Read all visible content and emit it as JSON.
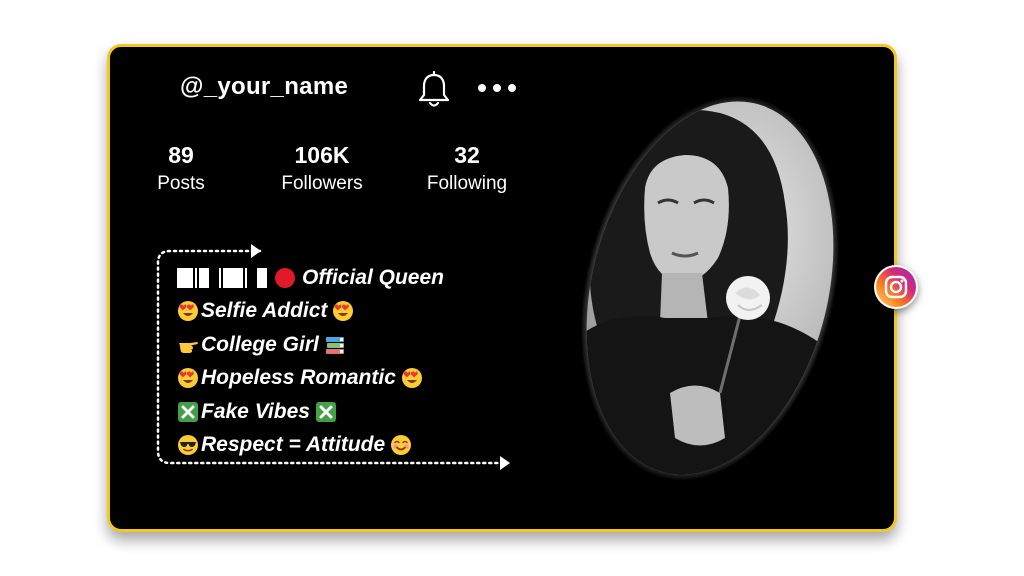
{
  "profile": {
    "username": "@_your_name",
    "stats": [
      {
        "value": "89",
        "label": "Posts"
      },
      {
        "value": "106K",
        "label": "Followers"
      },
      {
        "value": "32",
        "label": "Following"
      }
    ]
  },
  "bio": {
    "line1_text": "Official Queen",
    "line2_text": "Selfie Addict",
    "line3_text": "College Girl",
    "line4_text": "Hopeless Romantic",
    "line5_text": "Fake Vibes",
    "line6_text": "Respect = Attitude"
  },
  "icons": {
    "notification": "bell-icon",
    "more": "more-dots-icon",
    "social": "instagram-icon"
  },
  "colors": {
    "card_background": "#000000",
    "card_border": "#f2c81e",
    "text": "#ffffff",
    "red_dot": "#e0192b"
  }
}
